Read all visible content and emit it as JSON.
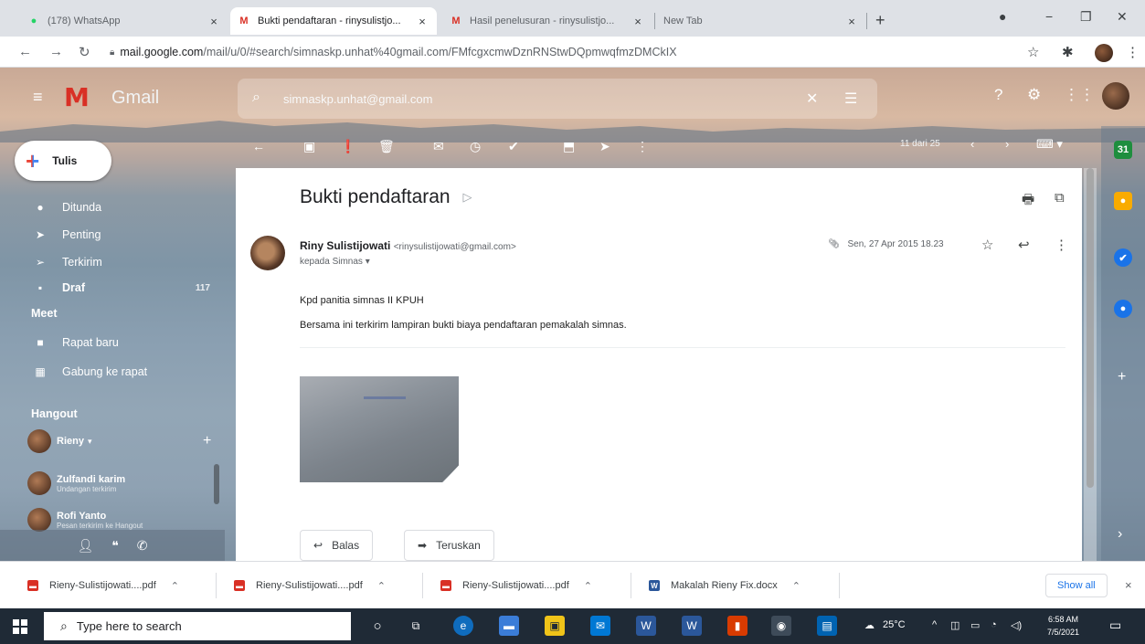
{
  "browser": {
    "tabs": [
      {
        "title": "(178) WhatsApp",
        "favicon": "whatsapp-icon",
        "color": "#25d366"
      },
      {
        "title": "Bukti pendaftaran - rinysulistjo...",
        "favicon": "gmail-icon",
        "color": "#d93025"
      },
      {
        "title": "Hasil penelusuran - rinysulistjo...",
        "favicon": "gmail-icon",
        "color": "#d93025"
      },
      {
        "title": "New Tab",
        "favicon": "",
        "color": ""
      }
    ],
    "tab_close": "×",
    "new_tab": "+",
    "url_host": "mail.google.com",
    "url_path": "/mail/u/0/#search/simnaskp.unhat%40gmail.com/FMfcgxcmwDznRNStwDQpmwqfmzDMCkIX"
  },
  "gmail": {
    "brand": "Gmail",
    "search_value": "simnaskp.unhat@gmail.com",
    "compose_label": "Tulis",
    "sidebar": [
      {
        "label": "Ditunda",
        "icon": "clock-icon",
        "glyph": "●",
        "count": ""
      },
      {
        "label": "Penting",
        "icon": "important-icon",
        "glyph": "➤",
        "count": ""
      },
      {
        "label": "Terkirim",
        "icon": "sent-icon",
        "glyph": "➢",
        "count": ""
      },
      {
        "label": "Draf",
        "icon": "draft-icon",
        "glyph": "▪",
        "count": "117"
      }
    ],
    "meet": {
      "heading": "Meet",
      "items": [
        {
          "label": "Rapat baru",
          "icon": "video-icon",
          "glyph": "■"
        },
        {
          "label": "Gabung ke rapat",
          "icon": "keyboard-icon",
          "glyph": "▦"
        }
      ]
    },
    "hangout": {
      "heading": "Hangout",
      "self": "Rieny",
      "add": "+",
      "contacts": [
        {
          "name": "Zulfandi karim",
          "sub": "Undangan terkirim"
        },
        {
          "name": "Rofi Yanto",
          "sub": "Pesan terkirim ke Hangout"
        }
      ]
    },
    "pager": "11 dari 25",
    "email": {
      "subject": "Bukti pendaftaran",
      "sender_name": "Riny Sulistijowati",
      "sender_email": "<rinysulistijowati@gmail.com>",
      "to_line": "kepada Simnas ▾",
      "date": "Sen, 27 Apr 2015 18.23",
      "body": [
        "Kpd panitia simnas II KPUH",
        "Bersama ini terkirim lampiran bukti biaya pendaftaran pemakalah simnas."
      ],
      "reply_label": "Balas",
      "forward_label": "Teruskan"
    }
  },
  "downloads": {
    "items": [
      {
        "name": "Rieny-Sulistijowati....pdf",
        "type": "pdf",
        "color": "#d93025"
      },
      {
        "name": "Rieny-Sulistijowati....pdf",
        "type": "pdf",
        "color": "#d93025"
      },
      {
        "name": "Rieny-Sulistijowati....pdf",
        "type": "pdf",
        "color": "#d93025"
      },
      {
        "name": "Makalah Rieny Fix.docx",
        "type": "docx",
        "color": "#2b579a"
      }
    ],
    "show_all": "Show all",
    "close": "×"
  },
  "taskbar": {
    "search_placeholder": "Type here to search",
    "weather": "25°C",
    "time": "6:58 AM",
    "date": "7/5/2021"
  }
}
